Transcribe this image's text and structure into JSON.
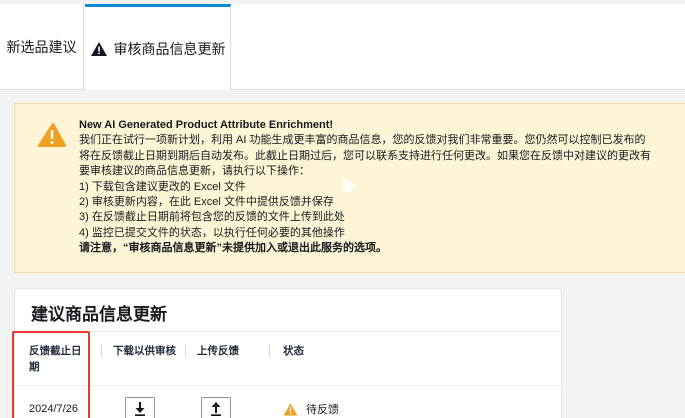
{
  "tabs": [
    {
      "label": "新选品建议"
    },
    {
      "label": "审核商品信息更新",
      "active": true,
      "icon": "warning-icon"
    }
  ],
  "alert": {
    "icon": "warning-icon",
    "title": "New AI Generated Product Attribute Enrichment!",
    "lines": [
      "我们正在试行一项新计划，利用 AI 功能生成更丰富的商品信息，您的反馈对我们非常重要。您仍然可以控制已发布的",
      "将在反馈截止日期到期后自动发布。此截止日期过后，您可以联系支持进行任何更改。如果您在反馈中对建议的更改有",
      "要审核建议的商品信息更新，请执行以下操作：",
      "1) 下载包含建议更改的 Excel 文件",
      "2) 审核更新内容，在此 Excel 文件中提供反馈并保存",
      "3) 在反馈截止日期前将包含您的反馈的文件上传到此处",
      "4) 监控已提交文件的状态，以执行任何必要的其他操作"
    ],
    "footer": "请注意，“审核商品信息更新”未提供加入或退出此服务的选项。"
  },
  "card": {
    "title": "建议商品信息更新",
    "columns": {
      "deadline": "反馈截止日期",
      "download": "下载以供审核",
      "upload": "上传反馈",
      "status": "状态"
    },
    "rows": [
      {
        "deadline": "2024/7/26",
        "download_icon": "download-icon",
        "upload_icon": "upload-icon",
        "status": "待反馈",
        "status_icon": "warning-icon"
      }
    ]
  },
  "colors": {
    "alert_bg": "#fef5d6",
    "warning": "#f0a020",
    "active_tab_border": "#0d8bd3",
    "highlight": "#e53935"
  }
}
